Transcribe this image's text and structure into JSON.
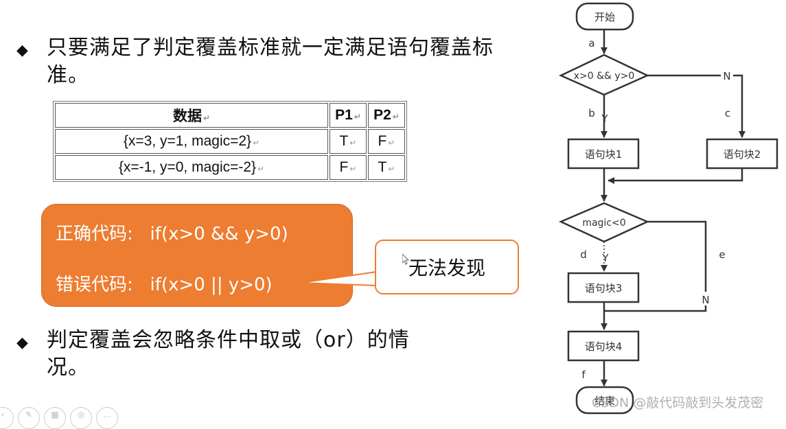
{
  "bullets": [
    {
      "icon": "diamond-bullet-icon",
      "glyph": "◆",
      "text": "只要满足了判定覆盖标准就一定满足语句覆盖标准。"
    },
    {
      "icon": "diamond-bullet-icon",
      "glyph": "◆",
      "text": "判定覆盖会忽略条件中取或（or）的情况。"
    }
  ],
  "table": {
    "headers": [
      "数据",
      "P1",
      "P2"
    ],
    "rows": [
      {
        "data": "{x=3, y=1, magic=2}",
        "p1": "T",
        "p2": "F"
      },
      {
        "data": "{x=-1, y=0, magic=-2}",
        "p1": "F",
        "p2": "T"
      }
    ],
    "return_mark": "↵"
  },
  "code_box": {
    "correct": "正确代码:   if(x>0 && y>0)",
    "wrong": "错误代码:   if(x>0 || y>0)",
    "background": "#ED7D31"
  },
  "callout": {
    "text": "无法发现",
    "border_color": "#ED7D31"
  },
  "flowchart": {
    "start": "开始",
    "end": "结束",
    "decision1": "x>0 && y>0",
    "decision2": "magic<0",
    "blocks": [
      "语句块1",
      "语句块2",
      "语句块3",
      "语句块4"
    ],
    "yes_label": "Y",
    "no_label": "N",
    "edge_labels": {
      "a": "a",
      "b": "b",
      "c": "c",
      "d": "d",
      "e": "e",
      "f": "f"
    }
  },
  "watermark": "CSDN @敲代码敲到头发茂密",
  "toolbar": {
    "buttons": [
      {
        "name": "prev-icon",
        "glyph": "‹"
      },
      {
        "name": "pen-icon",
        "glyph": "✎"
      },
      {
        "name": "grid-icon",
        "glyph": "▦"
      },
      {
        "name": "zoom-icon",
        "glyph": "◎"
      },
      {
        "name": "more-icon",
        "glyph": "…"
      }
    ]
  }
}
